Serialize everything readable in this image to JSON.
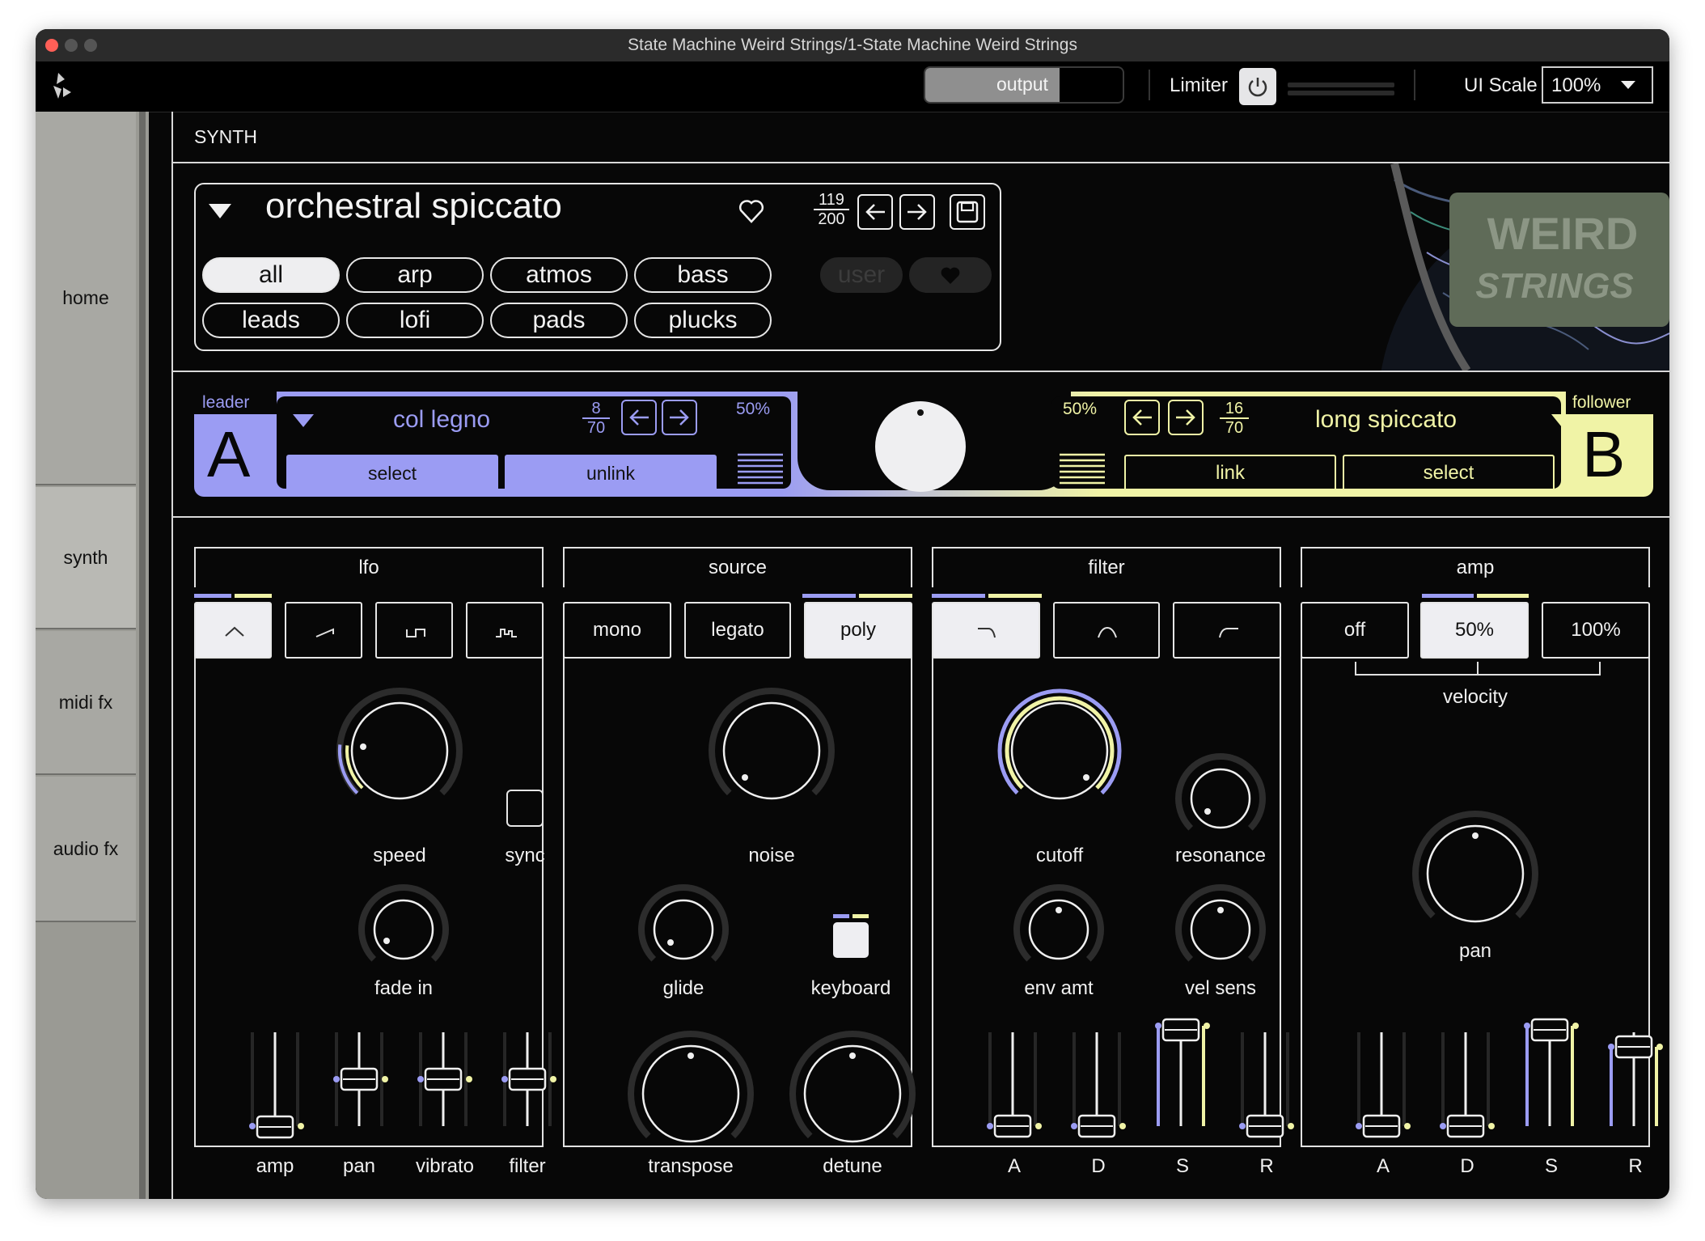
{
  "window": {
    "title": "State Machine Weird Strings/1-State Machine Weird Strings"
  },
  "toolbar": {
    "output_label": "output",
    "limiter_label": "Limiter",
    "ui_scale_label": "UI Scale",
    "ui_scale_value": "100%"
  },
  "sidebar": {
    "items": [
      {
        "label": "home"
      },
      {
        "label": "synth"
      },
      {
        "label": "midi fx"
      },
      {
        "label": "audio fx"
      }
    ]
  },
  "section_title": "SYNTH",
  "preset": {
    "name": "orchestral spiccato",
    "index": "119",
    "total": "200",
    "categories": [
      "all",
      "arp",
      "atmos",
      "bass",
      "leads",
      "lofi",
      "pads",
      "plucks"
    ],
    "selected_category": "all",
    "user_label": "user"
  },
  "leader": {
    "tag": "leader",
    "letter": "A",
    "name": "col legno",
    "index": "8",
    "total": "70",
    "mix": "50%",
    "select_label": "select",
    "unlink_label": "unlink"
  },
  "follower": {
    "tag": "follower",
    "letter": "B",
    "name": "long spiccato",
    "index": "16",
    "total": "70",
    "mix": "50%",
    "link_label": "link",
    "select_label": "select"
  },
  "lfo": {
    "title": "lfo",
    "knobs": {
      "speed": "speed",
      "sync": "sync",
      "fade_in": "fade in"
    },
    "sliders": [
      "amp",
      "pan",
      "vibrato",
      "filter"
    ]
  },
  "source": {
    "title": "source",
    "modes": [
      "mono",
      "legato",
      "poly"
    ],
    "selected_mode": "poly",
    "knobs": {
      "noise": "noise",
      "glide": "glide",
      "keyboard": "keyboard",
      "transpose": "transpose",
      "detune": "detune"
    }
  },
  "filter": {
    "title": "filter",
    "knobs": {
      "cutoff": "cutoff",
      "resonance": "resonance",
      "env_amt": "env amt",
      "vel_sens": "vel sens"
    },
    "sliders": [
      "A",
      "D",
      "S",
      "R"
    ]
  },
  "amp": {
    "title": "amp",
    "velocity_options": [
      "off",
      "50%",
      "100%"
    ],
    "selected_velocity": "50%",
    "velocity_label": "velocity",
    "knobs": {
      "pan": "pan"
    },
    "sliders": [
      "A",
      "D",
      "S",
      "R"
    ]
  },
  "colors": {
    "leader": "#9b9cf3",
    "follower": "#f0f3a6",
    "background": "#070707",
    "foreground": "#e8e8e8"
  }
}
